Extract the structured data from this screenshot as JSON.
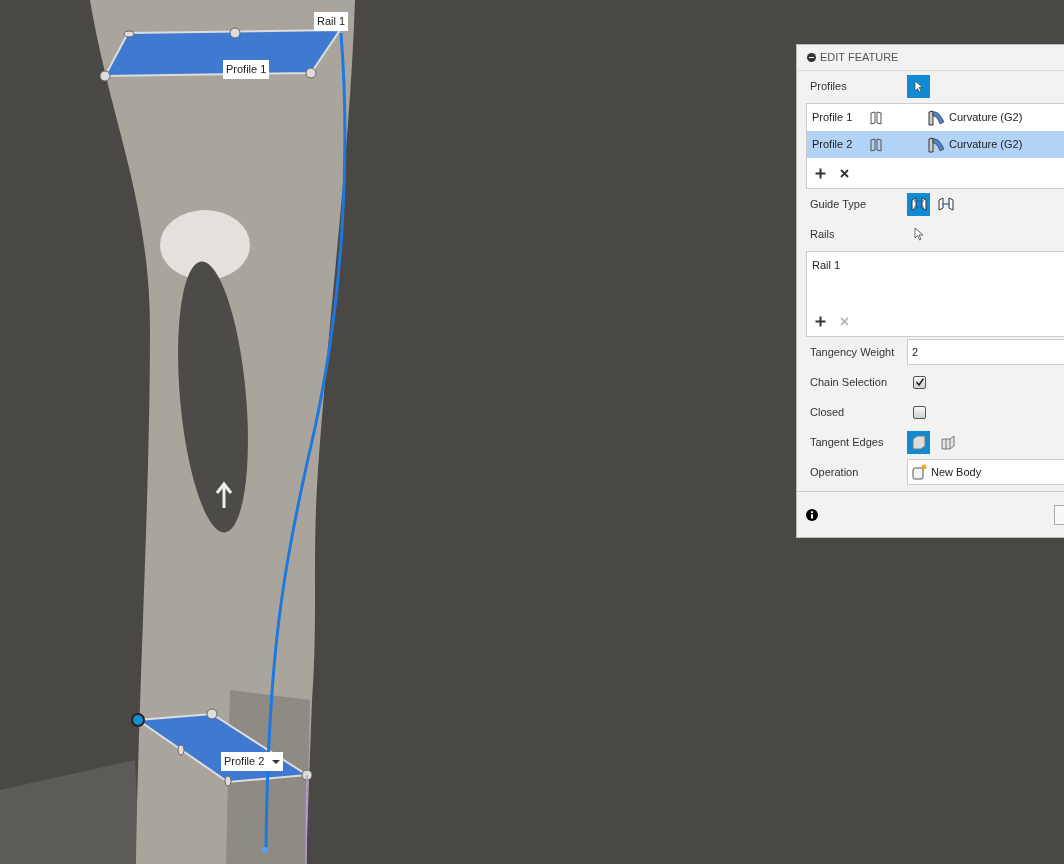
{
  "viewport": {
    "labels": [
      {
        "text": "Rail 1",
        "dropdown": false
      },
      {
        "text": "Profile 1",
        "dropdown": false
      },
      {
        "text": "Profile 2",
        "dropdown": true
      }
    ]
  },
  "panel": {
    "title": "EDIT FEATURE",
    "profiles_label": "Profiles",
    "profiles": [
      {
        "name": "Profile 1",
        "continuity": "Curvature (G2)",
        "selected": false
      },
      {
        "name": "Profile 2",
        "continuity": "Curvature (G2)",
        "selected": true
      }
    ],
    "profiles_remove_disabled": false,
    "guide_type": {
      "label": "Guide Type",
      "options": [
        {
          "selected": true
        },
        {
          "selected": false
        }
      ]
    },
    "rails_label": "Rails",
    "rails": [
      "Rail 1"
    ],
    "rails_remove_disabled": true,
    "tangency_weight": {
      "label": "Tangency Weight",
      "value": "2"
    },
    "chain_selection": {
      "label": "Chain Selection",
      "checked": true
    },
    "closed": {
      "label": "Closed",
      "checked": false
    },
    "tangent_edges": {
      "label": "Tangent Edges",
      "options": [
        {
          "selected": true
        },
        {
          "selected": false
        }
      ]
    },
    "operation": {
      "label": "Operation",
      "value": "New Body"
    }
  }
}
